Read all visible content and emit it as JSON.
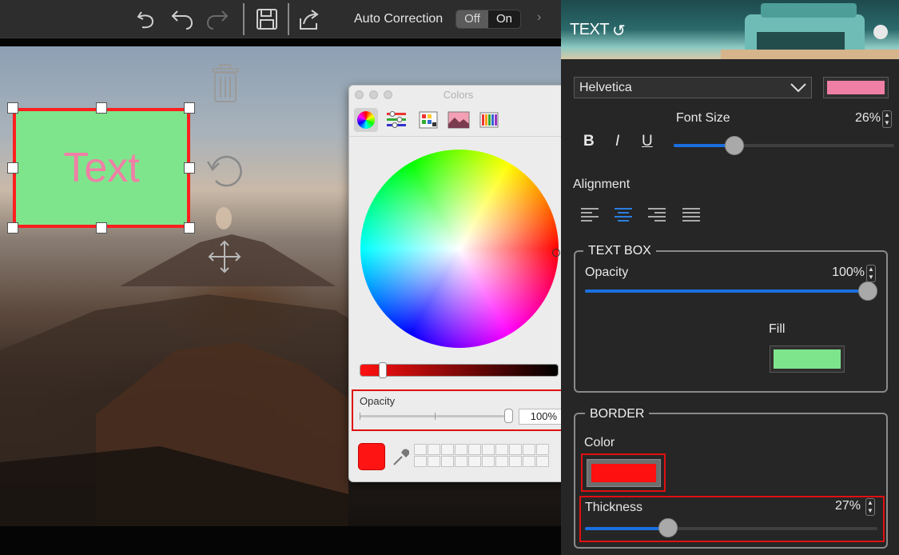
{
  "toolbar": {
    "icons": [
      "undo-all-icon",
      "undo-icon",
      "redo-icon",
      "save-icon",
      "share-icon"
    ],
    "auto_correction_label": "Auto Correction",
    "toggle_off": "Off",
    "toggle_on": "On",
    "toggle_selected": "Off",
    "chevron": "›"
  },
  "canvas": {
    "text_box_text": "Text",
    "text_box_fill": "#7fe58c",
    "text_box_border": "#ff1f1f",
    "text_color": "#f07fa6"
  },
  "colors_panel": {
    "title": "Colors",
    "modes": [
      "color-wheel",
      "sliders",
      "palettes",
      "image-palettes",
      "pencils"
    ],
    "active_mode": "color-wheel",
    "opacity_label": "Opacity",
    "opacity_value": "100%",
    "current_color": "#ff1414"
  },
  "inspector": {
    "banner_title": "TEXT",
    "banner_undo": "↺",
    "font_family": "Helvetica",
    "font_color": "#f07fa6",
    "font_size_label": "Font Size",
    "font_size_value": "26%",
    "font_size_level": 0.26,
    "style_bold": "B",
    "style_italic": "I",
    "style_underline": "U",
    "alignment_label": "Alignment",
    "alignment_options": [
      "left",
      "center",
      "right",
      "justify"
    ],
    "alignment_selected": "center",
    "text_box": {
      "title": "TEXT BOX",
      "opacity_label": "Opacity",
      "opacity_value": "100%",
      "opacity_level": 1.0,
      "fill_label": "Fill",
      "fill_color": "#7fe58c"
    },
    "border": {
      "title": "BORDER",
      "color_label": "Color",
      "color": "#ff1010",
      "thickness_label": "Thickness",
      "thickness_value": "27%",
      "thickness_level": 0.27
    }
  }
}
